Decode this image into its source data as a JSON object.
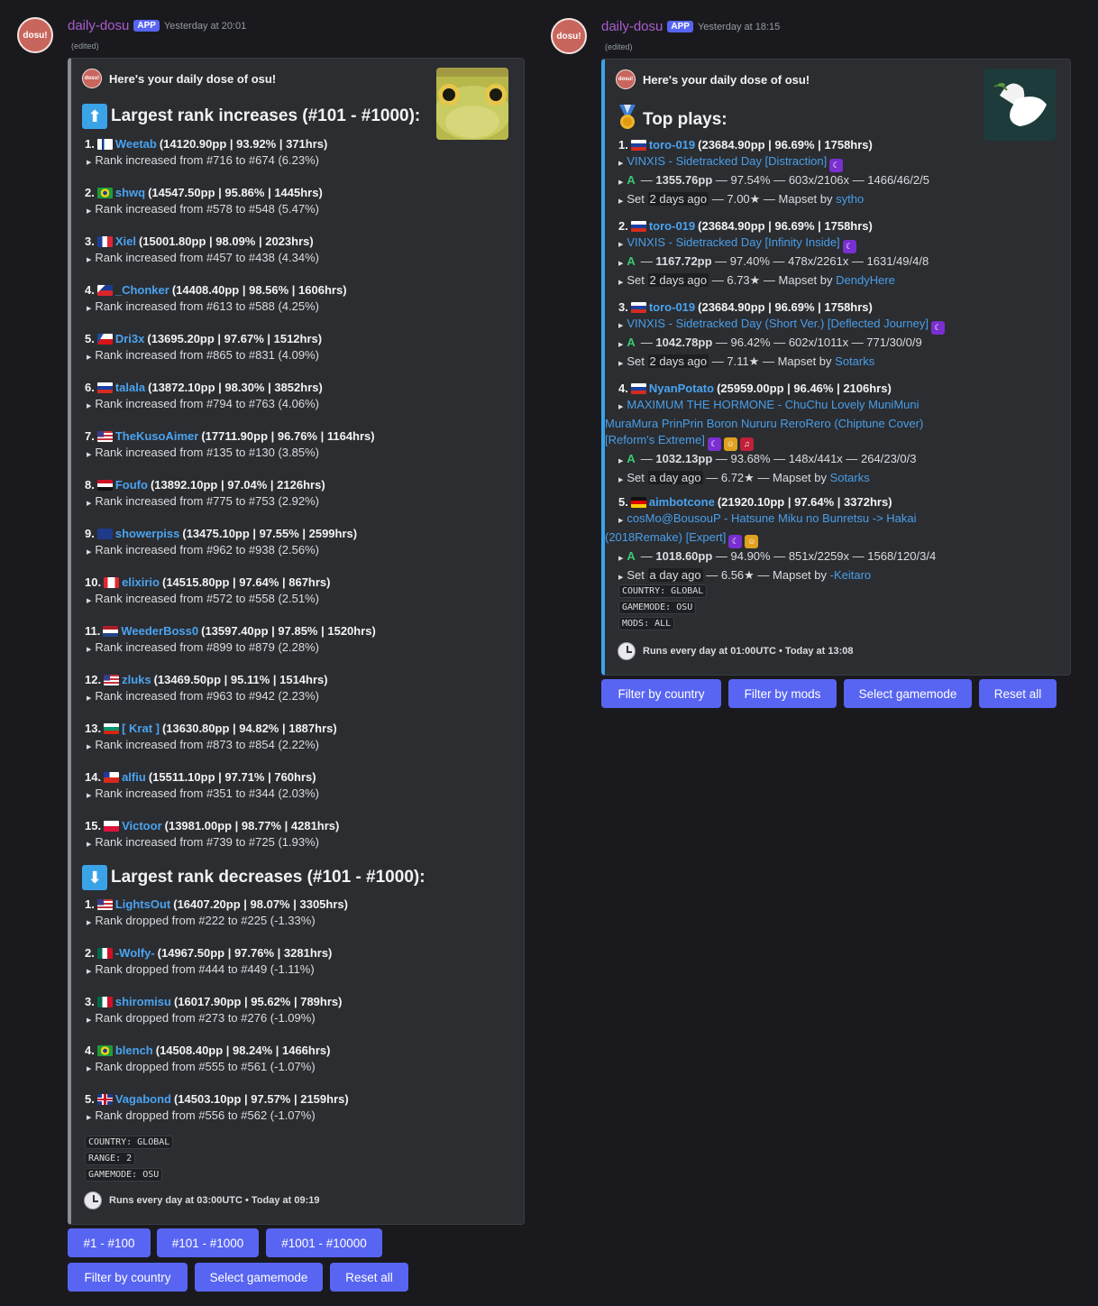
{
  "left": {
    "avatar": "dosu!",
    "bot": "daily-dosu",
    "badge": "APP",
    "time": "Yesterday at 20:01",
    "edited": "(edited)",
    "author": "Here's your daily dose of osu!",
    "title_up": "Largest rank increases (#101 - #1000):",
    "title_down": "Largest rank decreases (#101 - #1000):",
    "increases": [
      {
        "n": "1.",
        "flag": "fi",
        "user": "Weetab",
        "stats": "(14120.90pp | 93.92% | 371hrs)",
        "detail": "Rank increased from #716 to #674 (6.23%)"
      },
      {
        "n": "2.",
        "flag": "br",
        "user": "shwq",
        "stats": "(14547.50pp | 95.86% | 1445hrs)",
        "detail": "Rank increased from #578 to #548 (5.47%)"
      },
      {
        "n": "3.",
        "flag": "fr",
        "user": "Xiel",
        "stats": "(15001.80pp | 98.09% | 2023hrs)",
        "detail": "Rank increased from #457 to #438 (4.34%)"
      },
      {
        "n": "4.",
        "flag": "ph",
        "user": "_Chonker",
        "stats": "(14408.40pp | 98.56% | 1606hrs)",
        "detail": "Rank increased from #613 to #588 (4.25%)"
      },
      {
        "n": "5.",
        "flag": "cz",
        "user": "Dri3x",
        "stats": "(13695.20pp | 97.67% | 1512hrs)",
        "detail": "Rank increased from #865 to #831 (4.09%)"
      },
      {
        "n": "6.",
        "flag": "ru",
        "user": "talala",
        "stats": "(13872.10pp | 98.30% | 3852hrs)",
        "detail": "Rank increased from #794 to #763 (4.06%)"
      },
      {
        "n": "7.",
        "flag": "us",
        "user": "TheKusoAimer",
        "stats": "(17711.90pp | 96.76% | 1164hrs)",
        "detail": "Rank increased from #135 to #130 (3.85%)"
      },
      {
        "n": "8.",
        "flag": "eg",
        "user": "Foufo",
        "stats": "(13892.10pp | 97.04% | 2126hrs)",
        "detail": "Rank increased from #775 to #753 (2.92%)"
      },
      {
        "n": "9.",
        "flag": "au",
        "user": "showerpiss",
        "stats": "(13475.10pp | 97.55% | 2599hrs)",
        "detail": "Rank increased from #962 to #938 (2.56%)"
      },
      {
        "n": "10.",
        "flag": "ca",
        "user": "elixirio",
        "stats": "(14515.80pp | 97.64% | 867hrs)",
        "detail": "Rank increased from #572 to #558 (2.51%)"
      },
      {
        "n": "11.",
        "flag": "nl",
        "user": "WeederBoss0",
        "stats": "(13597.40pp | 97.85% | 1520hrs)",
        "detail": "Rank increased from #899 to #879 (2.28%)"
      },
      {
        "n": "12.",
        "flag": "us",
        "user": "zluks",
        "stats": "(13469.50pp | 95.11% | 1514hrs)",
        "detail": "Rank increased from #963 to #942 (2.23%)"
      },
      {
        "n": "13.",
        "flag": "bg",
        "user": "[ Krat ]",
        "stats": "(13630.80pp | 94.82% | 1887hrs)",
        "detail": "Rank increased from #873 to #854 (2.22%)"
      },
      {
        "n": "14.",
        "flag": "cl",
        "user": "alfiu",
        "stats": "(15511.10pp | 97.71% | 760hrs)",
        "detail": "Rank increased from #351 to #344 (2.03%)"
      },
      {
        "n": "15.",
        "flag": "pl",
        "user": "Victoor",
        "stats": "(13981.00pp | 98.77% | 4281hrs)",
        "detail": "Rank increased from #739 to #725 (1.93%)"
      }
    ],
    "decreases": [
      {
        "n": "1.",
        "flag": "us",
        "user": "LightsOut",
        "stats": "(16407.20pp | 98.07% | 3305hrs)",
        "detail": "Rank dropped from #222 to #225 (-1.33%)"
      },
      {
        "n": "2.",
        "flag": "mx",
        "user": "-Wolfy-",
        "stats": "(14967.50pp | 97.76% | 3281hrs)",
        "detail": "Rank dropped from #444 to #449 (-1.11%)"
      },
      {
        "n": "3.",
        "flag": "mx",
        "user": "shiromisu",
        "stats": "(16017.90pp | 95.62% | 789hrs)",
        "detail": "Rank dropped from #273 to #276 (-1.09%)"
      },
      {
        "n": "4.",
        "flag": "br",
        "user": "blench",
        "stats": "(14508.40pp | 98.24% | 1466hrs)",
        "detail": "Rank dropped from #555 to #561 (-1.07%)"
      },
      {
        "n": "5.",
        "flag": "gb",
        "user": "Vagabond",
        "stats": "(14503.10pp | 97.57% | 2159hrs)",
        "detail": "Rank dropped from #556 to #562 (-1.07%)"
      }
    ],
    "codes": [
      "COUNTRY: GLOBAL",
      "RANGE: 2",
      "GAMEMODE: OSU"
    ],
    "footer": "Runs every day at 03:00UTC • Today at 09:19",
    "buttons_row1": [
      "#1 - #100",
      "#101 - #1000",
      "#1001 - #10000"
    ],
    "buttons_row2": [
      "Filter by country",
      "Select gamemode",
      "Reset all"
    ]
  },
  "right": {
    "avatar": "dosu!",
    "bot": "daily-dosu",
    "badge": "APP",
    "time": "Yesterday at 18:15",
    "edited": "(edited)",
    "author": "Here's your daily dose of osu!",
    "title": "Top plays:",
    "plays": [
      {
        "n": "1.",
        "flag": "ru",
        "user": "toro-019",
        "stats": "(23684.90pp | 96.69% | 1758hrs)",
        "map": "VINXIS - Sidetracked Day [Distraction]",
        "mods": [
          "DT"
        ],
        "pp": "1355.76pp",
        "score": " — 97.54% — 603x/2106x — 1466/46/2/5",
        "set_pre": "Set ",
        "set_ago": "2 days ago",
        "set_mid": " — 7.00★ — Mapset by ",
        "mapper": "sytho"
      },
      {
        "n": "2.",
        "flag": "ru",
        "user": "toro-019",
        "stats": "(23684.90pp | 96.69% | 1758hrs)",
        "map": "VINXIS - Sidetracked Day [Infinity Inside]",
        "mods": [
          "DT"
        ],
        "pp": "1167.72pp",
        "score": " — 97.40% — 478x/2261x — 1631/49/4/8",
        "set_pre": "Set ",
        "set_ago": "2 days ago",
        "set_mid": " — 6.73★ — Mapset by ",
        "mapper": "DendyHere"
      },
      {
        "n": "3.",
        "flag": "ru",
        "user": "toro-019",
        "stats": "(23684.90pp | 96.69% | 1758hrs)",
        "map": "VINXIS - Sidetracked Day (Short Ver.) [Deflected Journey]",
        "mods": [
          "DT"
        ],
        "pp": "1042.78pp",
        "score": " — 96.42% — 602x/1011x — 771/30/0/9",
        "set_pre": "Set ",
        "set_ago": "2 days ago",
        "set_mid": " — 7.11★ — Mapset by ",
        "mapper": "Sotarks"
      },
      {
        "n": "4.",
        "flag": "ru",
        "user": "NyanPotato",
        "stats": "(25959.00pp | 96.46% | 2106hrs)",
        "map_lines": [
          "MAXIMUM THE HORMONE - ChuChu Lovely MuniMuni",
          "MuraMura PrinPrin Boron Nururu ReroRero (Chiptune Cover)",
          "[Reform's Extreme]"
        ],
        "mods": [
          "DT",
          "SD",
          "NC"
        ],
        "pp": "1032.13pp",
        "score": " — 93.68% — 148x/441x — 264/23/0/3",
        "set_pre": "Set ",
        "set_ago": "a day ago",
        "set_mid": " — 6.72★ — Mapset by ",
        "mapper": "Sotarks"
      },
      {
        "n": "5.",
        "flag": "de",
        "user": "aimbotcone",
        "stats": "(21920.10pp | 97.64% | 3372hrs)",
        "map_lines": [
          "cosMo@BousouP - Hatsune Miku no Bunretsu -> Hakai",
          "(2018Remake) [Expert]"
        ],
        "mods": [
          "DT",
          "SD"
        ],
        "pp": "1018.60pp",
        "score": " — 94.90% — 851x/2259x — 1568/120/3/4",
        "set_pre": "Set ",
        "set_ago": "a day ago",
        "set_mid": " — 6.56★ — Mapset by ",
        "mapper": "-Keitaro"
      }
    ],
    "codes": [
      "COUNTRY: GLOBAL",
      "GAMEMODE: OSU",
      "MODS: ALL"
    ],
    "footer": "Runs every day at 01:00UTC • Today at 13:08",
    "buttons": [
      "Filter by country",
      "Filter by mods",
      "Select gamemode",
      "Reset all"
    ]
  },
  "colors": {
    "accent": "#5865f2",
    "link": "#4aa3f0",
    "bot_name": "#a95dd0",
    "embed_bg": "#2b2d31"
  }
}
